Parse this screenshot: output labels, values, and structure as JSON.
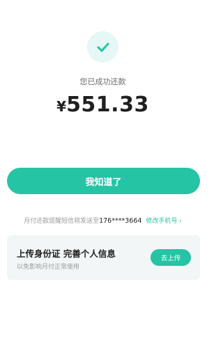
{
  "result": {
    "message": "您已成功还款",
    "currency_symbol": "¥",
    "amount": "551.33"
  },
  "actions": {
    "confirm_label": "我知道了"
  },
  "notice": {
    "text": "月付还款提醒短信将发送至",
    "phone": "176****3664",
    "change_phone_label": "修改手机号",
    "change_phone_arrow": "›"
  },
  "upload_card": {
    "title": "上传身份证 完善个人信息",
    "subtitle": "以免影响月付正常使用",
    "button_label": "去上传"
  },
  "colors": {
    "accent": "#25c4a4",
    "icon_bg": "#e6f8f5",
    "card_bg": "#f2f6f6"
  },
  "icons": {
    "success": "check-icon"
  }
}
